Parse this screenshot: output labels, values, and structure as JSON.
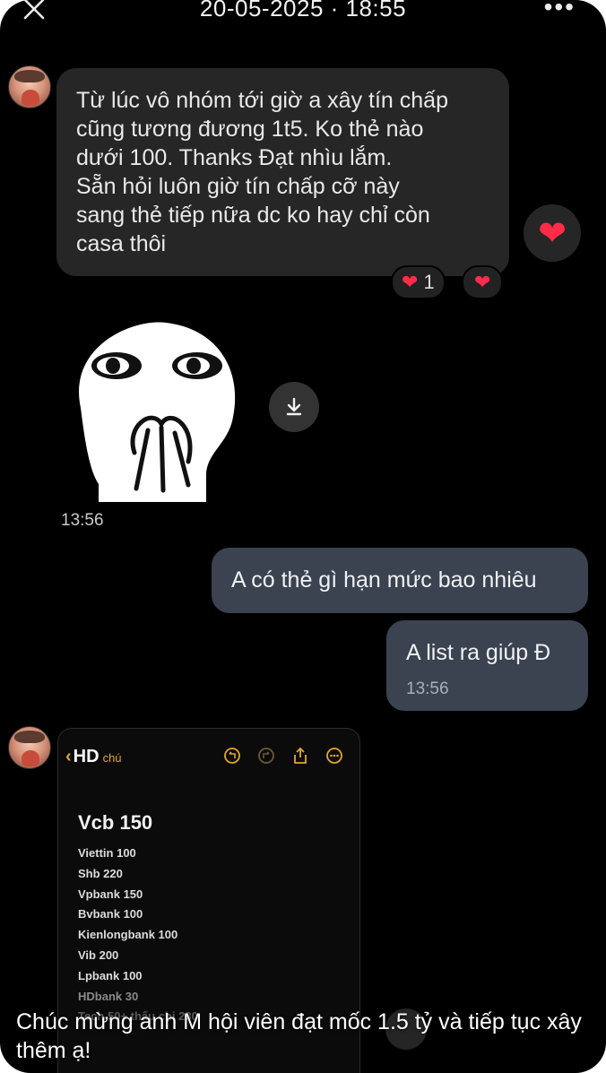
{
  "topbar": {
    "title": "20-05-2025 · 18:55",
    "close_icon": "close-icon",
    "more_icon": "more-horizontal-icon"
  },
  "messages": {
    "incoming_1": {
      "text": "Từ lúc vô nhóm tới giờ a xây tín chấp\ncũng tương đương 1t5. Ko thẻ nào\ndưới 100. Thanks Đạt nhìu lắm.\nSẵn hỏi luôn giờ tín chấp cỡ này\nsang thẻ tiếp nữa dc ko hay chỉ còn\ncasa thôi",
      "reaction_count": "1"
    },
    "sticker_time": "13:56",
    "outgoing_1": {
      "text": "A có thẻ gì hạn mức bao nhiêu"
    },
    "outgoing_2": {
      "text": "A list ra giúp Đ",
      "time": "13:56"
    }
  },
  "notes": {
    "back_label": "HD",
    "sub_label": "chú",
    "heading": "Vcb 150",
    "items": [
      "Viettin 100",
      "Shb 220",
      "Vpbank 150",
      "Bvbank 100",
      "Kienlongbank 100",
      "Vib 200",
      "Lpbank 100",
      "HDbank 30",
      "Tech 50+ thấu chi 230"
    ]
  },
  "caption": "Chúc mừng anh M hội viên đạt mốc 1.5 tỷ và tiếp tục xây thêm ạ!",
  "colors": {
    "background": "#000000",
    "incoming_bubble": "#262626",
    "outgoing_bubble": "#3b4250",
    "heart": "#ff2b48",
    "notes_accent": "#e4a72c"
  }
}
